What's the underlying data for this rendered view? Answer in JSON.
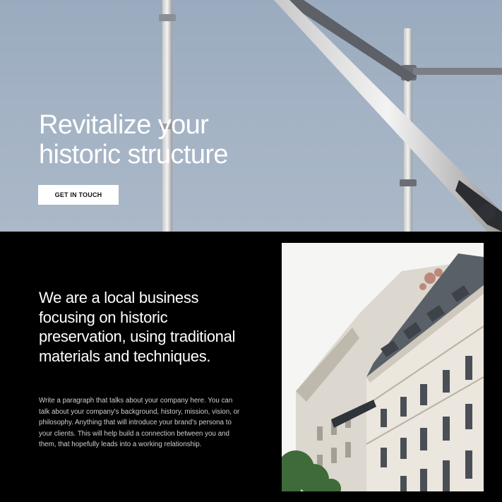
{
  "hero": {
    "title_line1": "Revitalize your",
    "title_line2": "historic structure",
    "cta_label": "GET IN TOUCH"
  },
  "about": {
    "heading": "We are a local business focusing on historic preservation, using traditional materials and techniques.",
    "body": "Write a paragraph that talks about your company here. You can talk about your company's background, history, mission, vision, or philosophy. Anything that will introduce your brand's persona to your clients. This will help build a connection between you and them, that hopefully leads into a working relationship."
  }
}
